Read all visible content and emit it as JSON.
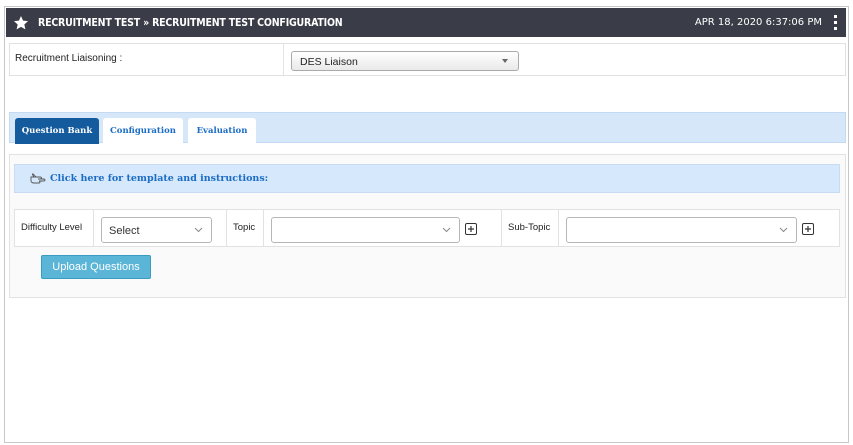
{
  "header": {
    "title": "RECRUITMENT TEST » RECRUITMENT TEST CONFIGURATION",
    "datetime": "APR 18, 2020  6:37:06 PM"
  },
  "liaison": {
    "label": "Recruitment Liaisoning :",
    "selected": "DES Liaison"
  },
  "tabs": [
    {
      "label": "Question Bank",
      "active": true
    },
    {
      "label": "Configuration",
      "active": false
    },
    {
      "label": "Evaluation",
      "active": false
    }
  ],
  "instructions_link": "Click here for template and instructions:",
  "filters": {
    "difficulty_label": "Difficulty Level",
    "difficulty_value": "Select",
    "topic_label": "Topic",
    "topic_value": "",
    "subtopic_label": "Sub-Topic",
    "subtopic_value": ""
  },
  "upload_button": "Upload Questions",
  "colors": {
    "header_bg": "#3a3d47",
    "active_tab": "#135b9c",
    "tab_strip": "#d6e7fa",
    "link_text": "#1b6cc5",
    "upload_button": "#5ab5d6"
  },
  "icons": {
    "header": "star-icon",
    "menu": "kebab-menu-icon",
    "instructions": "pointing-hand-icon",
    "add": "plus-square-icon",
    "dropdown": "chevron-down-icon"
  }
}
